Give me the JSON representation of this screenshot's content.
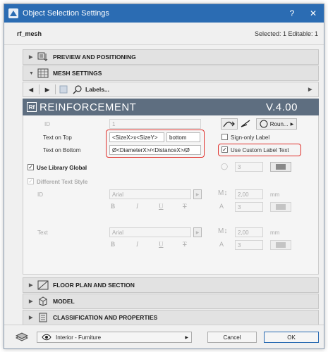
{
  "window": {
    "title": "Object Selection Settings",
    "help": "?",
    "close": "✕"
  },
  "header": {
    "object_name": "rf_mesh",
    "selection_info": "Selected: 1 Editable: 1"
  },
  "sections": {
    "preview": "PREVIEW AND POSITIONING",
    "mesh": "MESH SETTINGS",
    "floor_plan": "FLOOR PLAN AND SECTION",
    "model": "MODEL",
    "classification": "CLASSIFICATION AND PROPERTIES"
  },
  "nav": {
    "labels": "Labels..."
  },
  "banner": {
    "title": "REINFORCEMENT",
    "version": "V.4.00",
    "logo": "Rf"
  },
  "form": {
    "id_label": "ID",
    "id_value": "1",
    "text_on_top_label": "Text on Top",
    "text_on_top_value": "<SizeX>x<SizeY>",
    "text_on_top_position": "bottom",
    "text_on_bottom_label": "Text on Bottom",
    "text_on_bottom_value": "Ø<DiameterX>/<DistanceX>/Ø",
    "round_label": "Roun...",
    "sign_only_label": "Sign-only Label",
    "use_custom_label_text": "Use Custom Label Text",
    "use_library_global": "Use Library Global",
    "pen_value": "3",
    "different_text_style": "Different Text Style",
    "style_rows": [
      {
        "label": "ID",
        "font": "Arial",
        "size": "2,00",
        "unit": "mm",
        "pen": "3"
      },
      {
        "label": "Text",
        "font": "Arial",
        "size": "2,00",
        "unit": "mm",
        "pen": "3"
      }
    ],
    "style_buttons": {
      "bold": "B",
      "italic": "I",
      "underline": "U",
      "strike": "T"
    },
    "size_glyph": "M↕",
    "pen_glyph": "A"
  },
  "footer": {
    "layer": "Interior - Furniture",
    "cancel": "Cancel",
    "ok": "OK"
  },
  "colors": {
    "titlebar": "#2b6cb3",
    "banner": "#5e6e80",
    "highlight": "#e0302b"
  }
}
